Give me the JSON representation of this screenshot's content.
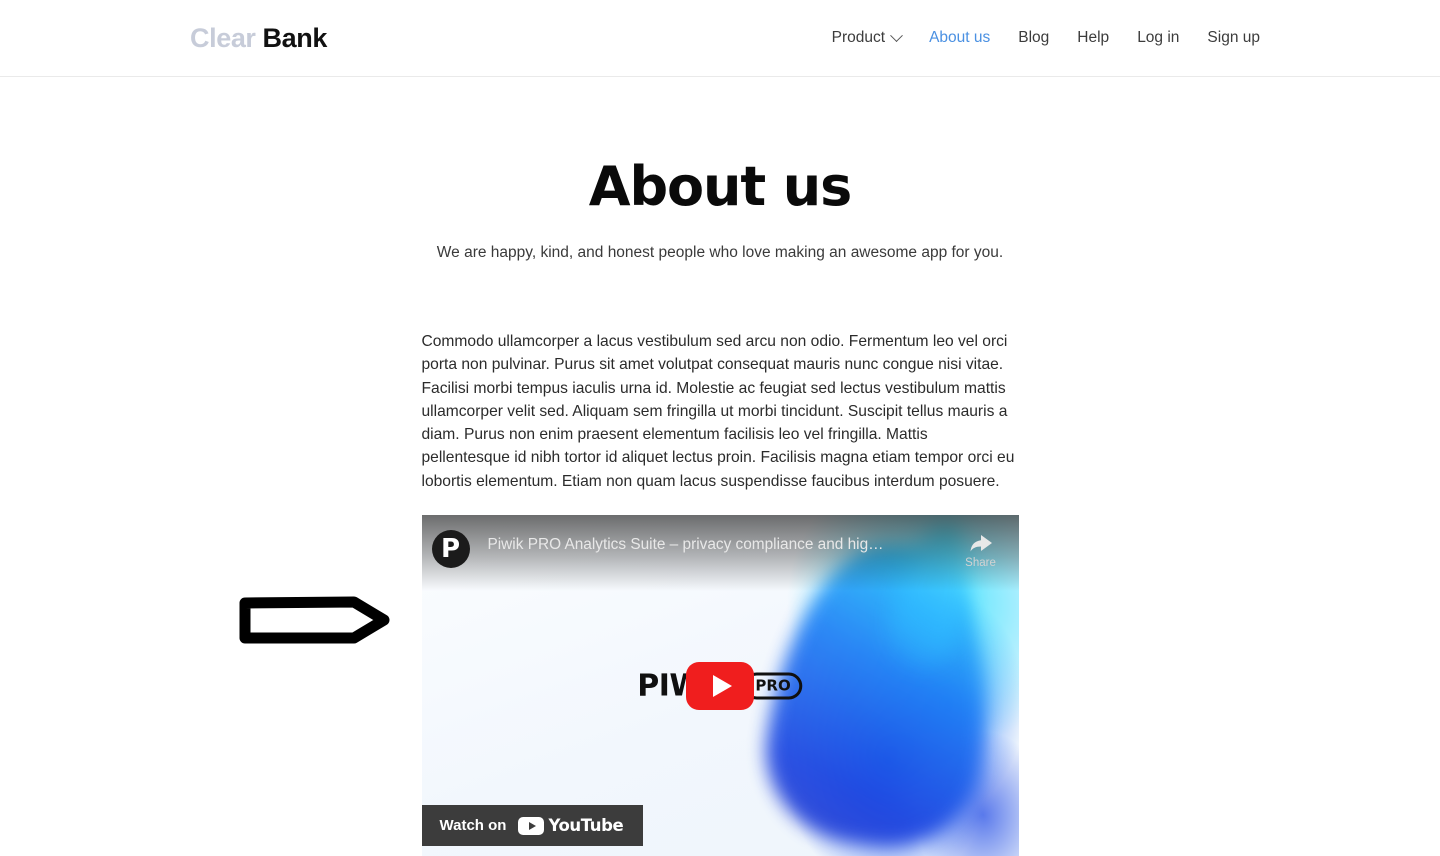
{
  "header": {
    "logo": {
      "primary": "Clear",
      "secondary": "Bank"
    },
    "nav": [
      {
        "label": "Product",
        "icon": "chevron-down-icon",
        "has_chevron": true,
        "active": false
      },
      {
        "label": "About us",
        "has_chevron": false,
        "active": true
      },
      {
        "label": "Blog",
        "has_chevron": false,
        "active": false
      },
      {
        "label": "Help",
        "has_chevron": false,
        "active": false
      },
      {
        "label": "Log in",
        "has_chevron": false,
        "active": false
      },
      {
        "label": "Sign up",
        "has_chevron": false,
        "active": false
      }
    ]
  },
  "hero": {
    "title": "About us",
    "subtitle": "We are happy, kind, and honest people who love making an awesome app for you."
  },
  "main": {
    "body_text": "Commodo ullamcorper a lacus vestibulum sed arcu non odio. Fermentum leo vel orci porta non pulvinar. Purus sit amet volutpat consequat mauris nunc congue nisi vitae. Facilisi morbi tempus iaculis urna id. Molestie ac feugiat sed lectus vestibulum mattis ullamcorper velit sed. Aliquam sem fringilla ut morbi tincidunt. Suscipit tellus mauris a diam. Purus non enim praesent elementum facilisis leo vel fringilla. Mattis pellentesque id nibh tortor id aliquet lectus proin. Facilisis magna etiam tempor orci eu lobortis elementum. Etiam non quam lacus suspendisse faucibus interdum posuere."
  },
  "video": {
    "title": "Piwik PRO Analytics Suite – privacy compliance and hig…",
    "channel_initial": "P",
    "share_label": "Share",
    "watch_on_label": "Watch on",
    "youtube_label": "YouTube",
    "wordmark_primary": "PIWIK",
    "wordmark_badge": "PRO",
    "play_button_color": "#f01e1e"
  },
  "annotation": {
    "shape": "right-arrow-outline",
    "stroke_color": "#000000"
  },
  "colors": {
    "accent_blue": "#4a90e2",
    "logo_muted": "#c7ccd9",
    "text_dark": "#2b2b2b",
    "border": "#eaeaea",
    "youtube_red": "#f01e1e"
  }
}
